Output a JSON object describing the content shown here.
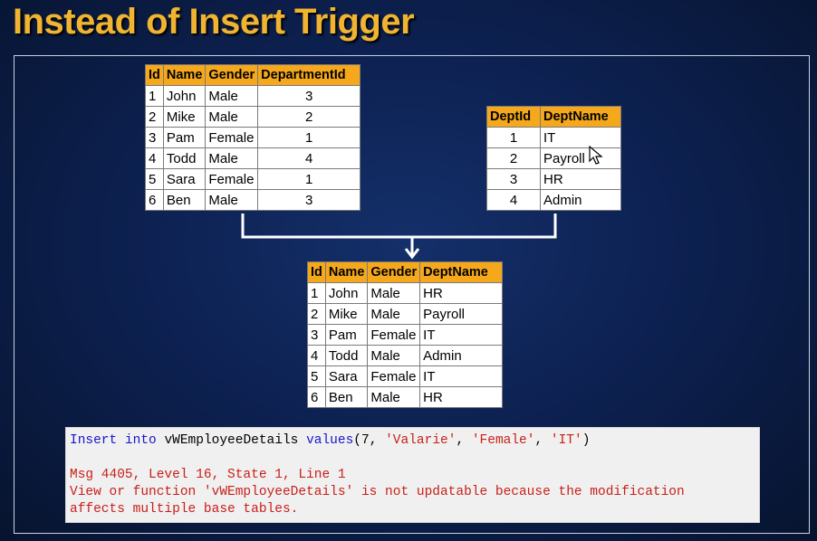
{
  "title": "Instead of Insert Trigger",
  "employee_table": {
    "headers": [
      "Id",
      "Name",
      "Gender",
      "DepartmentId"
    ],
    "rows": [
      [
        "1",
        "John",
        "Male",
        "3"
      ],
      [
        "2",
        "Mike",
        "Male",
        "2"
      ],
      [
        "3",
        "Pam",
        "Female",
        "1"
      ],
      [
        "4",
        "Todd",
        "Male",
        "4"
      ],
      [
        "5",
        "Sara",
        "Female",
        "1"
      ],
      [
        "6",
        "Ben",
        "Male",
        "3"
      ]
    ]
  },
  "department_table": {
    "headers": [
      "DeptId",
      "DeptName"
    ],
    "rows": [
      [
        "1",
        "IT"
      ],
      [
        "2",
        "Payroll"
      ],
      [
        "3",
        "HR"
      ],
      [
        "4",
        "Admin"
      ]
    ]
  },
  "view_table": {
    "headers": [
      "Id",
      "Name",
      "Gender",
      "DeptName"
    ],
    "rows": [
      [
        "1",
        "John",
        "Male",
        "HR"
      ],
      [
        "2",
        "Mike",
        "Male",
        "Payroll"
      ],
      [
        "3",
        "Pam",
        "Female",
        "IT"
      ],
      [
        "4",
        "Todd",
        "Male",
        "Admin"
      ],
      [
        "5",
        "Sara",
        "Female",
        "IT"
      ],
      [
        "6",
        "Ben",
        "Male",
        "HR"
      ]
    ]
  },
  "sql": {
    "kw_insert": "Insert",
    "kw_into": "into",
    "view_name": "vWEmployeeDetails",
    "kw_values": "values",
    "open": "(7,",
    "s1": "'Valarie'",
    "comma1": ",",
    "s2": "'Female'",
    "comma2": ",",
    "s3": "'IT'",
    "close": ")"
  },
  "error": {
    "line1": "Msg 4405, Level 16, State 1, Line 1",
    "line2": "View or function 'vWEmployeeDetails' is not updatable because the modification",
    "line3": "affects multiple base tables."
  },
  "colors": {
    "header_bg": "#f5a81c",
    "title": "#f0b431",
    "keyword": "#1a16c9",
    "string": "#c8201a"
  },
  "icons": [
    "mouse-pointer-icon"
  ]
}
